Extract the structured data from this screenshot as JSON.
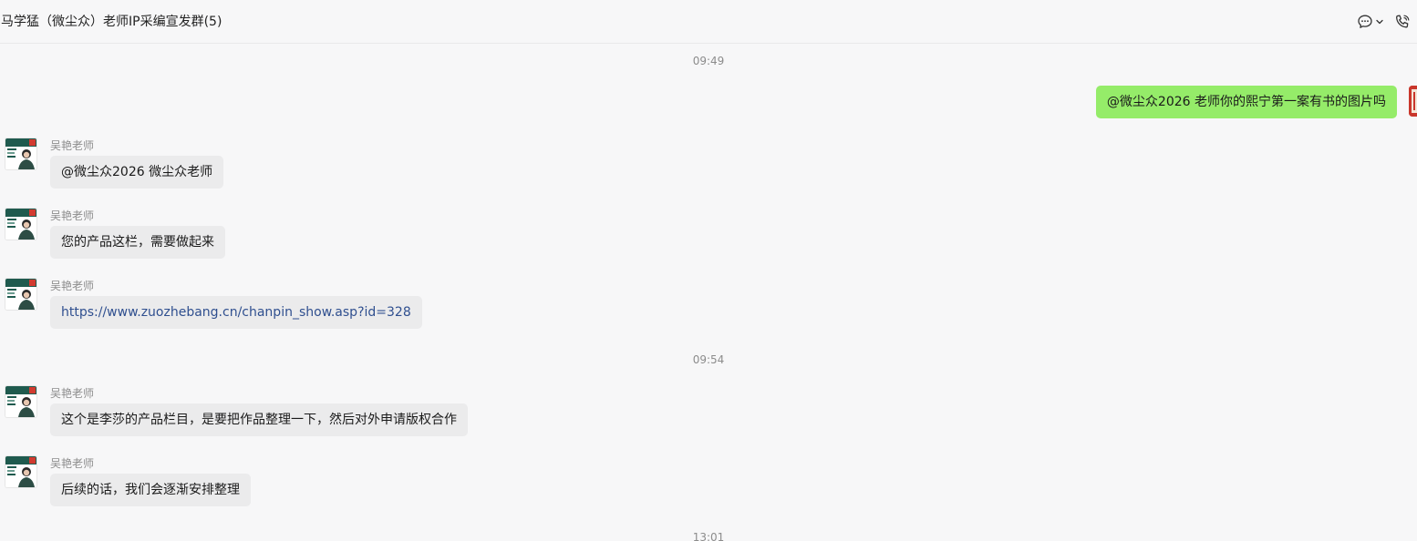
{
  "header": {
    "title": "马学猛（微尘众）老师IP采编宣发群(5)",
    "icons": [
      "chat-bubble-icon",
      "chevron-down-icon",
      "phone-icon"
    ]
  },
  "timestamps": [
    "09:49",
    "09:54",
    "13:01"
  ],
  "outgoing": {
    "text": "@微尘众2026 老师你的熙宁第一案有书的图片吗"
  },
  "sender_name": "吴艳老师",
  "messages": [
    {
      "sender": "吴艳老师",
      "text": "@微尘众2026 微尘众老师"
    },
    {
      "sender": "吴艳老师",
      "text": "您的产品这栏，需要做起来"
    },
    {
      "sender": "吴艳老师",
      "text": "https://www.zuozhebang.cn/chanpin_show.asp?id=328"
    },
    {
      "sender": "吴艳老师",
      "text": "这个是李莎的产品栏目，是要把作品整理一下，然后对外申请版权合作"
    },
    {
      "sender": "吴艳老师",
      "text": "后续的话，我们会逐渐安排整理"
    }
  ],
  "colors": {
    "outgoing_bubble": "#95ec69",
    "incoming_bubble": "#ebebec",
    "link": "#2f4f8f",
    "background": "#f7f7f8"
  }
}
